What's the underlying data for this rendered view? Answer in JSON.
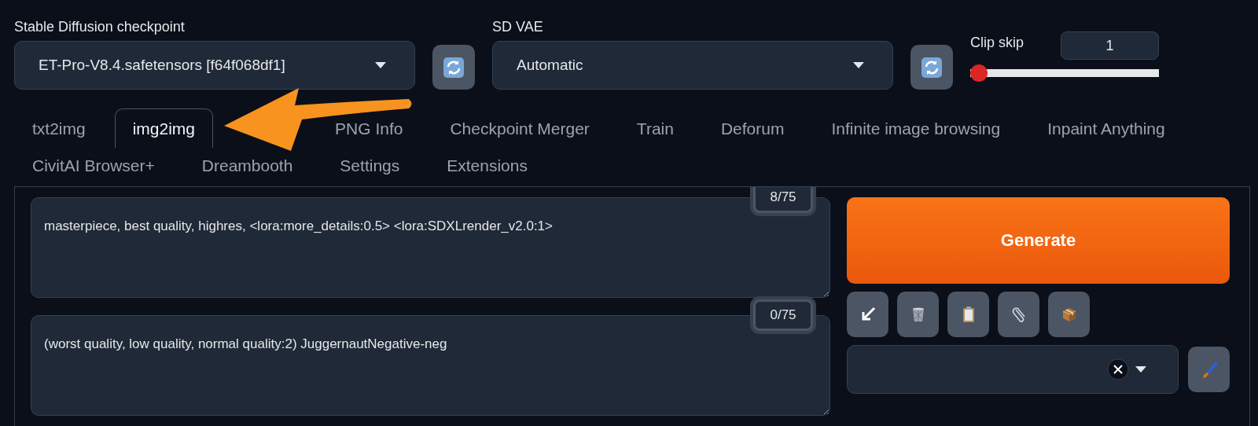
{
  "checkpoint": {
    "label": "Stable Diffusion checkpoint",
    "value": "ET-Pro-V8.4.safetensors [f64f068df1]"
  },
  "vae": {
    "label": "SD VAE",
    "value": "Automatic"
  },
  "clip_skip": {
    "label": "Clip skip",
    "value": "1",
    "level": 0
  },
  "tab_rows": [
    {
      "tabs": [
        {
          "label": "txt2img",
          "selected": false
        },
        {
          "label": "img2img",
          "selected": true
        },
        {
          "label": "PNG Info",
          "selected": false
        },
        {
          "label": "Checkpoint Merger",
          "selected": false
        },
        {
          "label": "Train",
          "selected": false
        },
        {
          "label": "Deforum",
          "selected": false
        },
        {
          "label": "Infinite image browsing",
          "selected": false
        },
        {
          "label": "Inpaint Anything",
          "selected": false
        }
      ]
    },
    {
      "tabs": [
        {
          "label": "CivitAI Browser+",
          "selected": false
        },
        {
          "label": "Dreambooth",
          "selected": false
        },
        {
          "label": "Settings",
          "selected": false
        },
        {
          "label": "Extensions",
          "selected": false
        }
      ]
    }
  ],
  "prompt": {
    "value": "masterpiece, best quality, highres, <lora:more_details:0.5> <lora:SDXLrender_v2.0:1>",
    "counter": "8/75"
  },
  "negative_prompt": {
    "value": "(worst quality, low quality, normal quality:2) JuggernautNegative-neg",
    "counter": "0/75"
  },
  "generate_button": "Generate",
  "tools": [
    {
      "kind": "arrow"
    },
    {
      "kind": "trash"
    },
    {
      "kind": "clipboard"
    },
    {
      "kind": "paperclip"
    },
    {
      "kind": "box"
    }
  ],
  "styles_dropdown": {
    "clearable": true
  }
}
